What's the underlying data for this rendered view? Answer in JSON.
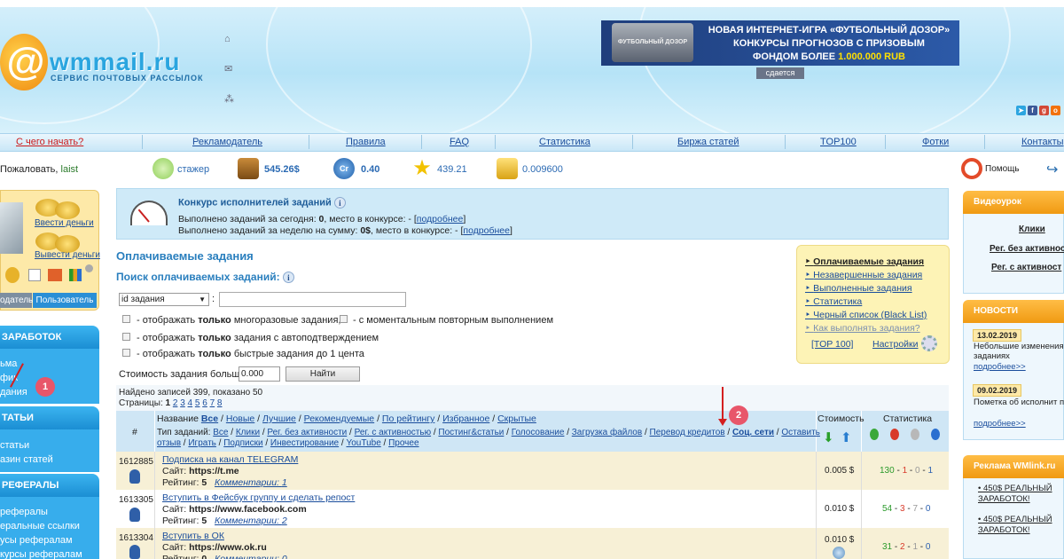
{
  "header": {
    "logo_text": "wmmail.ru",
    "logo_subtitle": "СЕРВИС ПОЧТОВЫХ РАССЫЛОК",
    "banner_line1": "НОВАЯ ИНТЕРНЕТ-ИГРА «ФУТБОЛЬНЫЙ ДОЗОР»",
    "banner_line2": "КОНКУРСЫ ПРОГНОЗОВ С ПРИЗОВЫМ",
    "banner_line3a": "ФОНДОМ БОЛЕЕ ",
    "banner_line3b": "1.000.000 RUB",
    "banner_img_text": "ФУТБОЛЬНЫЙ ДОЗОР",
    "banner_rent": "сдается"
  },
  "nav": [
    "С чего начать?",
    "Рекламодатель",
    "Правила",
    "FAQ",
    "Статистика",
    "Биржа статей",
    "TOP100",
    "Фотки",
    "Контакты"
  ],
  "userbar": {
    "welcome": "Пожаловать,",
    "username": "laist",
    "rank": "стажер",
    "balance": "545.26$",
    "credits": "0.40",
    "rating": "439.21",
    "coins": "0.009600",
    "help": "Помощь"
  },
  "sidebar": {
    "deposit": "Ввести деньги",
    "withdraw": "Вывести деньги",
    "tab_advertiser": "одатель",
    "tab_user": "Пользователь",
    "sections": [
      {
        "title": "ЗАРАБОТОК",
        "items": [
          "ьма",
          "фик",
          "дания"
        ]
      },
      {
        "title": "ТАТЬИ",
        "items": [
          "статьи",
          "азин статей"
        ]
      },
      {
        "title": "РЕФЕРАЛЫ",
        "items": [
          "рефералы",
          "еральные ссылки",
          "усы рефералам",
          "курсы рефералам"
        ]
      }
    ]
  },
  "contest": {
    "title": "Конкурс исполнителей заданий",
    "line1_pre": "Выполнено заданий за сегодня: ",
    "line1_val": "0",
    "line1_post": ", место в конкурсе: - [",
    "line1_link": "подробнее",
    "line2_pre": "Выполнено заданий за неделю на сумму: ",
    "line2_val": "0$",
    "line2_post": ", место в конкурсе: - [",
    "line2_link": "подробнее",
    "close": "]"
  },
  "main": {
    "title": "Оплачиваемые задания",
    "search_title": "Поиск оплачиваемых заданий:",
    "select_value": "id задания",
    "colon": ":",
    "opt1_pre": "- отображать ",
    "opt1_bold": "только",
    "opt1_post": " многоразовые задания,",
    "opt1b": "- с моментальным повторным выполнением",
    "opt2_pre": "- отображать ",
    "opt2_bold": "только",
    "opt2_post": " задания с автоподтверждением",
    "opt3_pre": "- отображать ",
    "opt3_bold": "только",
    "opt3_post": " быстрые задания до 1 цента",
    "cost_label": "Стоимость задания больше",
    "cost_value": "0.000",
    "find_button": "Найти",
    "found": "Найдено записей 399, показано 50",
    "pages_label": "Страницы:",
    "pages": [
      "1",
      "2",
      "3",
      "4",
      "5",
      "6",
      "7",
      "8"
    ]
  },
  "rightpanel": {
    "links": [
      "Оплачиваемые задания",
      "Незавершенные задания",
      "Выполненные задания",
      "Статистика",
      "Черный список (Black List)",
      "Как выполнять задания?"
    ],
    "top": "[TOP 100]",
    "settings": "Настройки"
  },
  "table": {
    "hash": "#",
    "name_label": "Название",
    "name_filters": [
      "Все",
      "Новые",
      "Лучшие",
      "Рекомендуемые",
      "По рейтингу",
      "Избранное",
      "Скрытые"
    ],
    "type_label": "Тип заданий:",
    "type_filters_line1": [
      "Все",
      "Клики",
      "Рег. без активности",
      "Рег. с активностью",
      "Постинг&статьи",
      "Голосование",
      "Загрузка файлов",
      "Перевод кредитов",
      "Соц. сети",
      "Оставить"
    ],
    "type_filters_line2": [
      "отзыв",
      "Играть",
      "Подписки",
      "Инвестирование",
      "YouTube",
      "Прочее"
    ],
    "col_cost": "Стоимость",
    "col_stats": "Статистика",
    "site_label": "Сайт: ",
    "rating_label": "Рейтинг: ",
    "comments_label": "Комментарии: ",
    "rows": [
      {
        "id": "1612885",
        "title": "Подписка на канал TELEGRAM",
        "site": "https://t.me",
        "rating": "5",
        "comments": "1",
        "cost": "0.005 $",
        "s1": "130",
        "s2": "1",
        "s3": "0",
        "s4": "1"
      },
      {
        "id": "1613305",
        "title": "Вступить в Фейсбук группу и сделать репост",
        "site": "https://www.facebook.com",
        "rating": "5",
        "comments": "2",
        "cost": "0.010 $",
        "s1": "54",
        "s2": "3",
        "s3": "7",
        "s4": "0"
      },
      {
        "id": "1613304",
        "title": "Вступить в ОК",
        "site": "https://www.ok.ru",
        "rating": "0",
        "comments": "0",
        "cost": "0.010 $",
        "s1": "31",
        "s2": "2",
        "s3": "1",
        "s4": "0"
      }
    ]
  },
  "rightcol": {
    "video_title": "Видеоурок",
    "video_links": [
      "Клики",
      "Рег. без активност",
      "Рег. с активност"
    ],
    "news_title": "НОВОСТИ",
    "news": [
      {
        "date": "13.02.2019",
        "text": "Небольшие изменения заданиях",
        "more": "подробнее>>"
      },
      {
        "date": "09.02.2019",
        "text": "Пометка об исполнит проверке задания",
        "more": "подробнее>>"
      }
    ],
    "ads_title": "Реклама WMlink.ru",
    "ads": [
      "• 450$ РЕАЛЬНЫЙ ЗАРАБОТОК!",
      "• 450$ РЕАЛЬНЫЙ ЗАРАБОТОК!"
    ]
  },
  "markers": [
    "1",
    "2"
  ]
}
